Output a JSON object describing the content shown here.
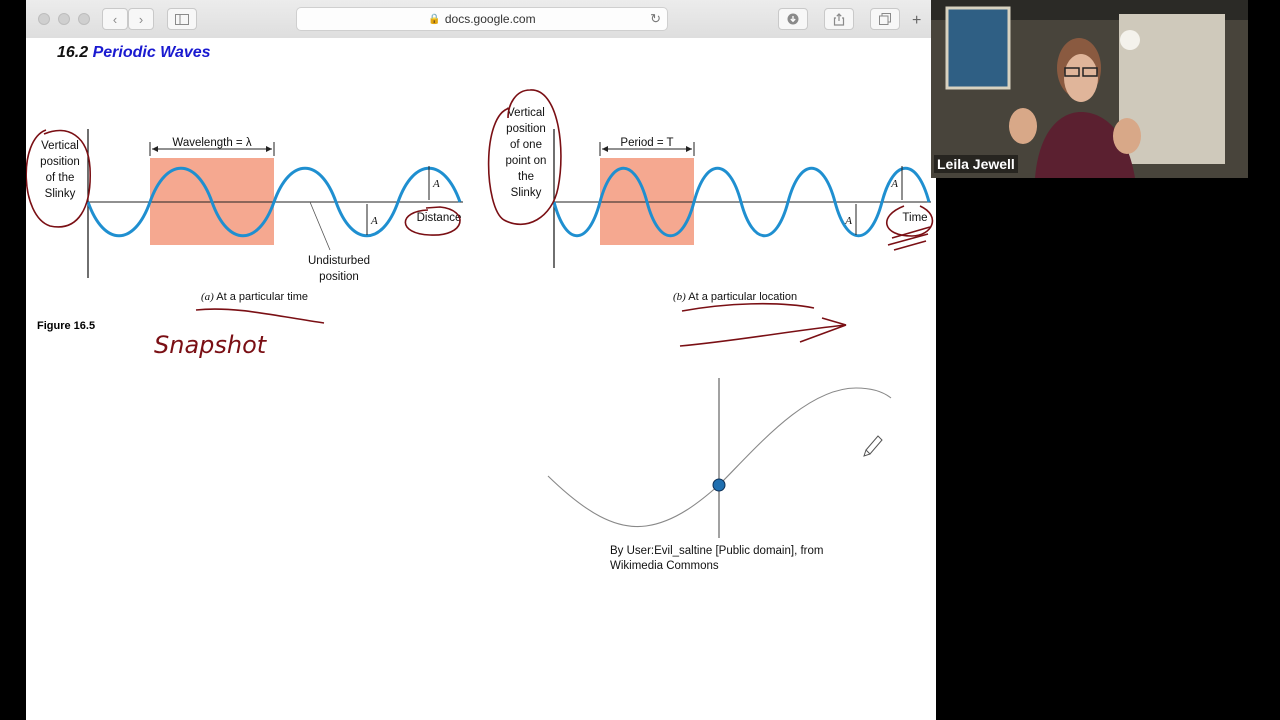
{
  "browser": {
    "url": "docs.google.com",
    "nav": {
      "back": "‹",
      "forward": "›"
    }
  },
  "document": {
    "section_number": "16.2",
    "section_title": "Periodic Waves",
    "figure_label": "Figure 16.5",
    "panel_a": {
      "y_axis_label": [
        "Vertical",
        "position",
        "of the",
        "Slinky"
      ],
      "wavelength_label": "Wavelength = λ",
      "amplitude_label": "A",
      "x_axis_label": "Distance",
      "undisturbed_label": [
        "Undisturbed",
        "position"
      ],
      "caption_letter": "(a)",
      "caption_text": "At a particular time"
    },
    "panel_b": {
      "y_axis_label": [
        "Vertical",
        "position",
        "of one",
        "point on",
        "the",
        "Slinky"
      ],
      "period_label": "Period = T",
      "amplitude_label": "A",
      "x_axis_label": "Time",
      "caption_letter": "(b)",
      "caption_text": "At a particular location"
    },
    "handwriting": {
      "snapshot": "Snapshot"
    },
    "credit": [
      "By User:Evil_saltine [Public domain], from",
      "Wikimedia Commons"
    ]
  },
  "video": {
    "speaker_name": "Leila Jewell"
  },
  "colors": {
    "wave_blue": "#1f8fd0",
    "highlight_salmon": "#f5a890",
    "ink_red": "#7a0f14",
    "title_blue": "#1a1ad0",
    "dot_blue": "#1f6fb0"
  },
  "icons": [
    "lock-icon",
    "reload-icon",
    "download-icon",
    "share-icon",
    "tabs-icon",
    "sidebar-icon",
    "pencil-cursor-icon"
  ]
}
